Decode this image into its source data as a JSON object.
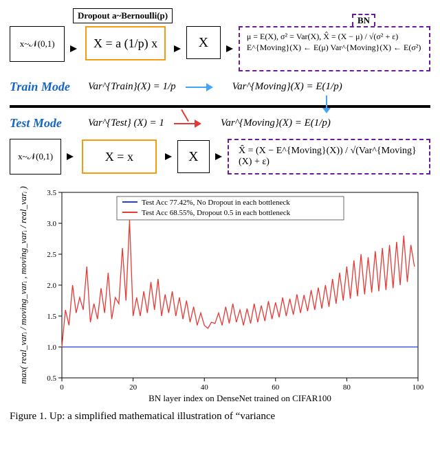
{
  "diagram": {
    "dropout_header": "Dropout  a~Bernoulli(p)",
    "bn_tag": "BN",
    "x_input": "x~𝒩(0,1)",
    "dropout_eq_train": "X = a (1/p) x",
    "big_x": "X",
    "bn_top_line": "μ = E(X), σ² = Var(X),  X̂ = (X − μ) / √(σ² + ε)",
    "bn_bottom_line": "E^{Moving}(X) ← E(μ)    Var^{Moving}(X) ← E(σ²)",
    "train_label": "Train Mode",
    "train_eq_left": "Var^{Train}(X) = 1/p",
    "moving_eq": "Var^{Moving}(X) = E(1/p)",
    "test_label": "Test  Mode",
    "test_eq_left": "Var^{Test} (X) = 1",
    "dropout_eq_test": "X = x",
    "test_xhat": "X̂ = (X − E^{Moving}(X)) / √(Var^{Moving}(X) + ε)"
  },
  "chart_data": {
    "type": "line",
    "ylabel": "max( real_varᵢ / moving_varᵢ , moving_varᵢ / real_varᵢ )",
    "xlabel": "BN layer index on DenseNet trained on CIFAR100",
    "xlim": [
      0,
      100
    ],
    "ylim": [
      0.5,
      3.5
    ],
    "yticks": [
      0.5,
      1.0,
      1.5,
      2.0,
      2.5,
      3.0,
      3.5
    ],
    "xticks": [
      0,
      20,
      40,
      60,
      80,
      100
    ],
    "series": [
      {
        "name": "Test Acc 77.42%, No Dropout in each bottleneck",
        "color": "#1f3fd6",
        "x": [
          0,
          5,
          10,
          15,
          20,
          25,
          30,
          35,
          40,
          45,
          50,
          55,
          60,
          65,
          70,
          75,
          80,
          85,
          90,
          95,
          100
        ],
        "y": [
          1.0,
          1.0,
          1.0,
          1.0,
          1.0,
          1.0,
          1.0,
          1.0,
          1.0,
          1.0,
          1.0,
          1.0,
          1.0,
          1.0,
          1.0,
          1.0,
          1.0,
          1.0,
          1.0,
          1.0,
          1.0
        ]
      },
      {
        "name": "Test Acc 68.55%, Dropout 0.5 in each bottleneck",
        "color": "#e53935",
        "x": [
          0,
          1,
          2,
          3,
          4,
          5,
          6,
          7,
          8,
          9,
          10,
          11,
          12,
          13,
          14,
          15,
          16,
          17,
          18,
          19,
          20,
          21,
          22,
          23,
          24,
          25,
          26,
          27,
          28,
          29,
          30,
          31,
          32,
          33,
          34,
          35,
          36,
          37,
          38,
          39,
          40,
          41,
          42,
          43,
          44,
          45,
          46,
          47,
          48,
          49,
          50,
          51,
          52,
          53,
          54,
          55,
          56,
          57,
          58,
          59,
          60,
          61,
          62,
          63,
          64,
          65,
          66,
          67,
          68,
          69,
          70,
          71,
          72,
          73,
          74,
          75,
          76,
          77,
          78,
          79,
          80,
          81,
          82,
          83,
          84,
          85,
          86,
          87,
          88,
          89,
          90,
          91,
          92,
          93,
          94,
          95,
          96,
          97,
          98,
          99
        ],
        "y": [
          1.0,
          1.6,
          1.35,
          2.0,
          1.55,
          1.8,
          1.6,
          2.3,
          1.4,
          1.7,
          1.45,
          1.95,
          1.55,
          2.2,
          1.45,
          1.8,
          1.7,
          2.6,
          1.75,
          3.05,
          1.5,
          1.8,
          1.5,
          1.9,
          1.55,
          2.05,
          1.6,
          2.1,
          1.5,
          1.85,
          1.55,
          1.9,
          1.5,
          1.8,
          1.45,
          1.75,
          1.4,
          1.65,
          1.35,
          1.55,
          1.35,
          1.3,
          1.4,
          1.38,
          1.55,
          1.35,
          1.65,
          1.38,
          1.7,
          1.4,
          1.6,
          1.35,
          1.62,
          1.38,
          1.7,
          1.4,
          1.67,
          1.42,
          1.74,
          1.45,
          1.72,
          1.48,
          1.8,
          1.5,
          1.78,
          1.52,
          1.85,
          1.55,
          1.84,
          1.58,
          1.92,
          1.6,
          1.96,
          1.62,
          2.0,
          1.65,
          2.1,
          1.7,
          2.2,
          1.75,
          2.3,
          1.78,
          2.4,
          1.82,
          2.5,
          1.85,
          2.45,
          1.88,
          2.55,
          1.9,
          2.6,
          1.92,
          2.65,
          1.95,
          2.7,
          2.0,
          2.8,
          2.05,
          2.65,
          2.3
        ]
      }
    ]
  },
  "caption": "Figure 1. Up: a simplified mathematical illustration of “variance"
}
